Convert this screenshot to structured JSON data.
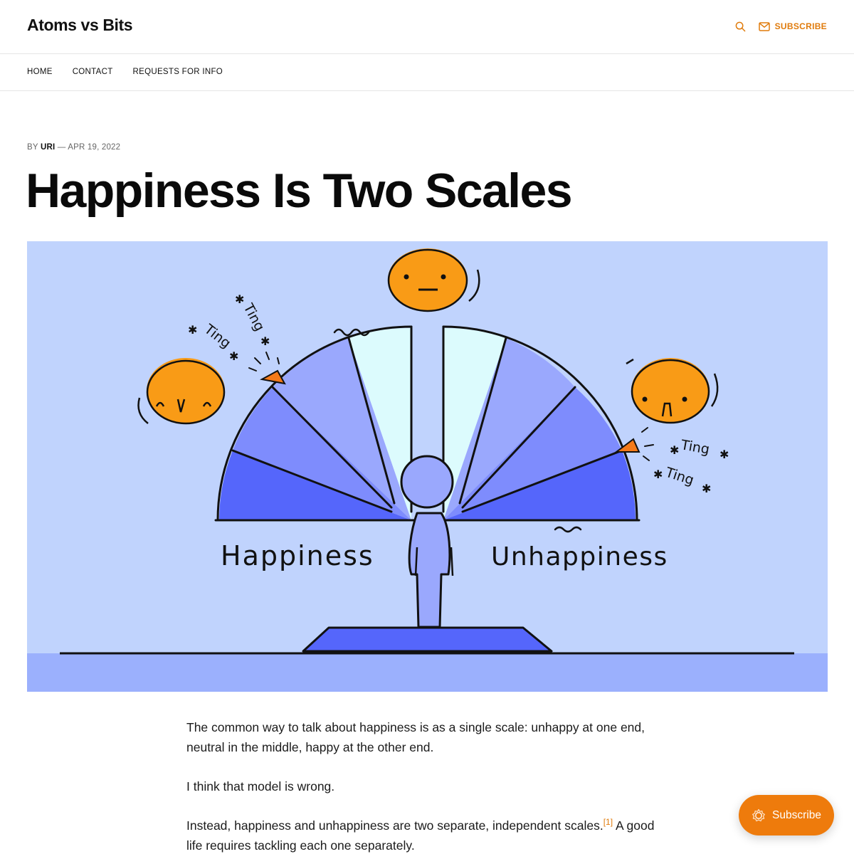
{
  "header": {
    "site_title": "Atoms vs Bits",
    "search_icon": "search-icon",
    "subscribe_icon": "mail-icon",
    "subscribe_label": "SUBSCRIBE",
    "accent_color": "#e07b0c"
  },
  "nav": {
    "items": [
      {
        "label": "HOME"
      },
      {
        "label": "CONTACT"
      },
      {
        "label": "REQUESTS FOR INFO"
      }
    ]
  },
  "post": {
    "byline_prefix": "BY",
    "author": "URI",
    "date_separator": "—",
    "date": "APR 19, 2022",
    "title": "Happiness Is Two Scales"
  },
  "hero": {
    "label_left": "Happiness",
    "label_right": "Unhappiness",
    "sound_word": "Ting",
    "background_color": "#c0d3fd",
    "face_color": "#f99b16"
  },
  "content": {
    "paragraphs": [
      "The common way to talk about happiness is as a single scale: unhappy at one end, neutral in the middle, happy at the other end.",
      "I think that model is wrong.",
      "Instead, happiness and unhappiness are two separate, independent scales.",
      "A good life requires tackling each one separately."
    ],
    "footnote_marker": "[1]"
  },
  "float_button": {
    "label": "Subscribe",
    "icon": "gear-badge-icon",
    "color": "#ee7b0c"
  }
}
